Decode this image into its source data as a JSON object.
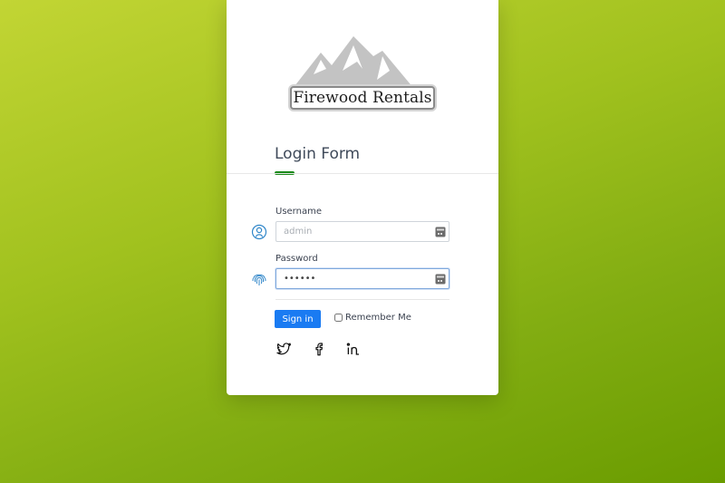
{
  "brand": {
    "name": "Firewood Rentals",
    "logo_icon": "mountain-logo-icon"
  },
  "form": {
    "title": "Login Form",
    "username": {
      "label": "Username",
      "placeholder": "admin",
      "value": "",
      "icon": "user-circle-icon"
    },
    "password": {
      "label": "Password",
      "placeholder": "",
      "value": "••••••",
      "icon": "fingerprint-icon"
    },
    "signin_label": "Sign in",
    "remember_label": "Remember Me",
    "remember_checked": false
  },
  "social": [
    "twitter-icon",
    "facebook-icon",
    "linkedin-icon"
  ],
  "colors": {
    "accent": "#1a7bf2",
    "title_underline": "#1a8a1a",
    "icon_blue": "#2f86c9"
  }
}
